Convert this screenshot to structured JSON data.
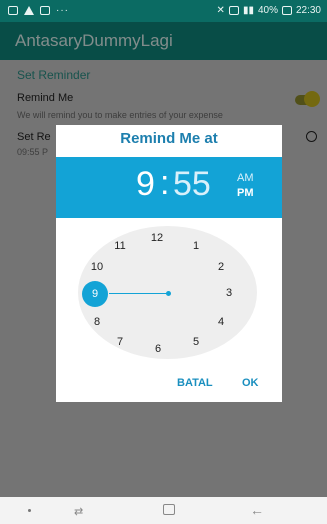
{
  "status_bar": {
    "dots": "···",
    "right_text": "40%",
    "time": "22:30"
  },
  "app": {
    "title": "AntasaryDummyLagi"
  },
  "background": {
    "section_title": "Set Reminder",
    "remind_me_label": "Remind Me",
    "remind_me_sub": "We will remind you to make entries of your expense",
    "set_reminder_label": "Set Re",
    "set_reminder_sub": "09:55 P",
    "toggle_on": true
  },
  "dialog": {
    "title": "Remind Me at",
    "hour": "9",
    "colon": ":",
    "minute": "55",
    "am_label": "AM",
    "pm_label": "PM",
    "selected_period": "PM",
    "dial_numbers": [
      "12",
      "1",
      "2",
      "3",
      "4",
      "5",
      "6",
      "7",
      "8",
      "9",
      "10",
      "11"
    ],
    "selected_hour": "9",
    "cancel_label": "BATAL",
    "ok_label": "OK"
  },
  "colors": {
    "primary": "#0e867b",
    "status": "#0b6b63",
    "dialog_header": "#13a3d6",
    "accent_text": "#1d7fae",
    "toggle": "#c9b51d"
  },
  "nav_bar": {
    "recent_icon": "recent-apps-icon",
    "home_icon": "home-icon",
    "back_icon": "back-arrow-icon"
  }
}
